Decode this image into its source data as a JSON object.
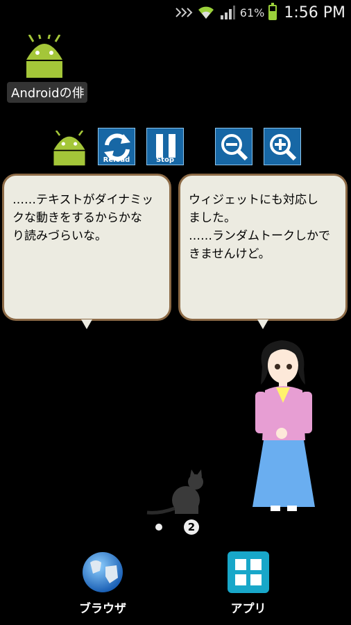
{
  "status_bar": {
    "battery_percent": "61%",
    "time": "1:56 PM",
    "icons": [
      "nfc-icon",
      "wifi-icon",
      "signal-icon",
      "battery-icon"
    ],
    "battery_level": 0.61
  },
  "desktop": {
    "shortcut_label": "Androidの俳"
  },
  "widget": {
    "buttons": [
      {
        "name": "reload-button",
        "label": "Reload",
        "icon": "refresh-icon"
      },
      {
        "name": "stop-button",
        "label": "Stop",
        "icon": "pause-icon"
      },
      {
        "name": "zoom-out-button",
        "label": "",
        "icon": "zoom-out-icon"
      },
      {
        "name": "zoom-in-button",
        "label": "",
        "icon": "zoom-in-icon"
      }
    ],
    "bubble_left": "……テキストがダイナミッ\nクな動きをするからかな\nり読みづらいな。",
    "bubble_right": "ウィジェットにも対応し\nました。\n……ランダムトークしかで\nきませんけど。"
  },
  "pager": {
    "current_page": "2"
  },
  "dock": {
    "browser_label": "ブラウザ",
    "apps_label": "アプリ"
  },
  "colors": {
    "background": "#000000",
    "button_blue": "#1767a5",
    "bubble_fill": "#ecebe1",
    "bubble_border": "#8c6a46",
    "android_green": "#a4c639"
  }
}
